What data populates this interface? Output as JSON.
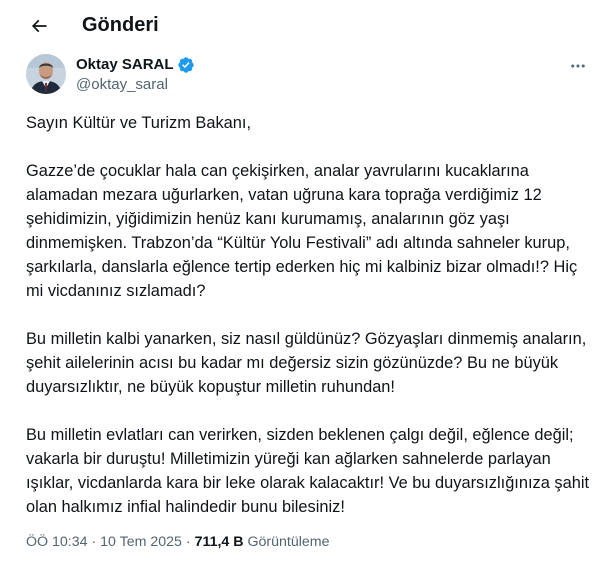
{
  "header": {
    "title": "Gönderi",
    "back_icon": "arrow-left-icon"
  },
  "author": {
    "name": "Oktay SARAL",
    "handle": "@oktay_saral",
    "verified": true,
    "verified_color": "#1d9bf0",
    "more_icon": "more-horizontal-icon"
  },
  "tweet": {
    "paragraphs": [
      "Sayın Kültür ve Turizm Bakanı,",
      "Gazze’de çocuklar hala can çekişirken, analar yavrularını kucaklarına alamadan mezara uğurlarken, vatan uğruna kara toprağa verdiğimiz 12 şehidimizin, yiğidimizin henüz kanı kurumamış, analarının göz yaşı dinmemişken. Trabzon’da “Kültür Yolu Festivali” adı altında sahneler kurup, şarkılarla, danslarla eğlence tertip ederken hiç mi kalbiniz bizar olmadı!? Hiç mi vicdanınız sızlamadı?",
      "Bu milletin kalbi yanarken, siz nasıl güldünüz? Gözyaşları dinmemiş anaların, şehit ailelerinin acısı bu kadar mı değersiz sizin gözünüzde? Bu ne büyük duyarsızlıktır, ne büyük kopuştur milletin ruhundan!",
      "Bu milletin evlatları can verirken, sizden beklenen çalgı değil, eğlence değil; vakarla bir duruştu! Milletimizin yüreği kan ağlarken sahnelerde parlayan ışıklar, vicdanlarda kara bir leke olarak kalacaktır! Ve bu duyarsızlığınıza şahit olan halkımız infial halindedir bunu bilesiniz!"
    ]
  },
  "meta": {
    "time": "ÖÖ 10:34",
    "separator": "·",
    "date": "10 Tem 2025",
    "views_count": "711,4 B",
    "views_label": "Görüntüleme"
  },
  "colors": {
    "text_primary": "#0f1419",
    "text_secondary": "#536471",
    "accent": "#1d9bf0"
  }
}
